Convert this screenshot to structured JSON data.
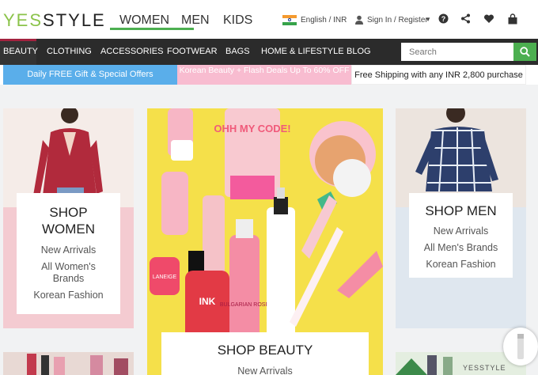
{
  "brand": {
    "logo_prefix": "YES",
    "logo_suffix": "STYLE"
  },
  "gender_tabs": [
    {
      "label": "WOMEN",
      "active": true
    },
    {
      "label": "MEN"
    },
    {
      "label": "KIDS"
    }
  ],
  "utility": {
    "locale": "English / INR",
    "signin": "Sign In / Register",
    "icons": [
      "help-icon",
      "share-icon",
      "heart-icon",
      "bag-icon"
    ]
  },
  "categories": [
    "BEAUTY",
    "CLOTHING",
    "ACCESSORIES",
    "FOOTWEAR",
    "BAGS",
    "HOME & LIFESTYLE",
    "BLOG"
  ],
  "search": {
    "placeholder": "Search"
  },
  "promos": [
    "Daily FREE Gift & Special Offers",
    "Korean Beauty + Flash Deals Up To 60% OFF",
    "Free Shipping with any INR 2,800 purchase"
  ],
  "panels": {
    "women": {
      "title_line1": "SHOP",
      "title_line2": "WOMEN",
      "links": [
        "New Arrivals",
        "All Women's Brands",
        "Korean Fashion"
      ]
    },
    "beauty": {
      "title": "SHOP BEAUTY",
      "links": [
        "New Arrivals"
      ]
    },
    "men": {
      "title": "SHOP MEN",
      "links": [
        "New Arrivals",
        "All Men's Brands",
        "Korean Fashion"
      ]
    }
  },
  "product_labels": [
    "OHH MY CODE!",
    "LANEIGE",
    "INK",
    "BULGARIAN ROSE"
  ],
  "footer_logo": "YESSTYLE",
  "colors": {
    "accent_green": "#4caf50",
    "beauty_yellow": "#f5e04a",
    "pink": "#f3c7cf",
    "nav_dark": "#2b2b2b"
  }
}
